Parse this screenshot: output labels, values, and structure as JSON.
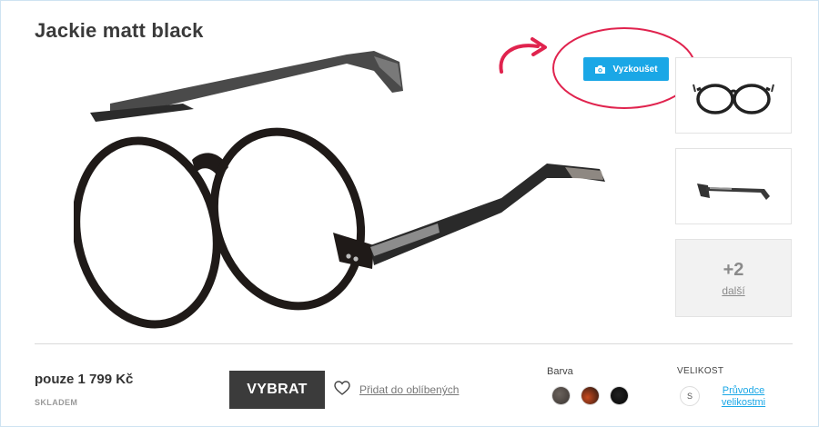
{
  "product": {
    "title": "Jackie matt black",
    "price": "pouze 1 799 Kč",
    "stock_status": "SKLADEM"
  },
  "tryon": {
    "label": "Vyzkoušet",
    "icon": "camera-icon",
    "highlight_color": "#e0234e",
    "button_color": "#1aa7e6"
  },
  "gallery": {
    "thumbnails": [
      "front-view",
      "side-view"
    ],
    "more_count": "+2",
    "more_label": "další"
  },
  "actions": {
    "buy_label": "VYBRAT",
    "favorite_label": "Přidat do oblíbených",
    "favorite_icon": "heart-icon"
  },
  "color": {
    "label": "Barva",
    "swatches": [
      "#4e4743",
      "#a33a17",
      "#111111"
    ]
  },
  "size": {
    "label": "VELIKOST",
    "options": [
      "S"
    ],
    "guide_label": "Průvodce velikostmi"
  }
}
